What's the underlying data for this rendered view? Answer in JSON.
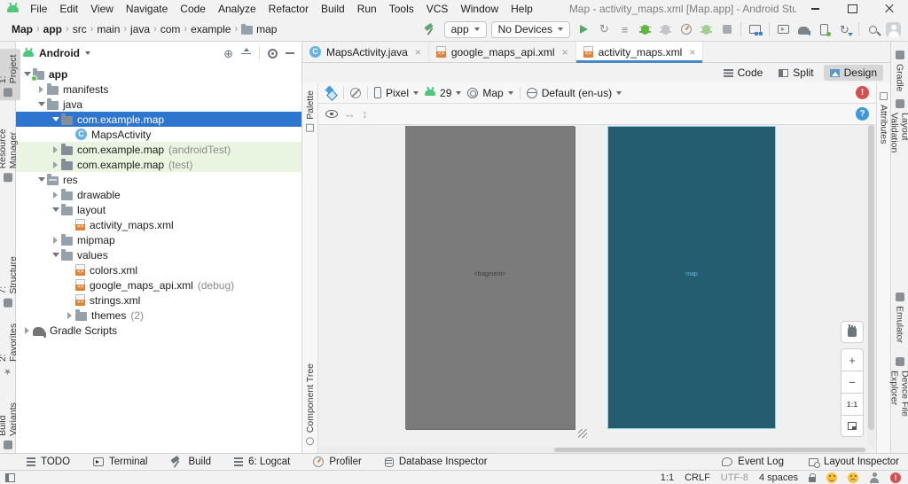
{
  "window": {
    "title": "Map - activity_maps.xml [Map.app] - Android Studio",
    "controls": [
      "minimize-icon",
      "maximize-icon",
      "close-icon"
    ]
  },
  "menubar": [
    "File",
    "Edit",
    "View",
    "Navigate",
    "Code",
    "Analyze",
    "Refactor",
    "Build",
    "Run",
    "Tools",
    "VCS",
    "Window",
    "Help"
  ],
  "breadcrumbs": [
    "Map",
    "app",
    "src",
    "main",
    "java",
    "com",
    "example",
    "map"
  ],
  "run_toolbar": {
    "config": "app",
    "devices": "No Devices",
    "icons": [
      "run-button",
      "restart-activity-button",
      "apply-changes-button",
      "debug-button",
      "attach-debugger-button",
      "profile-button",
      "apply-code-changes-button",
      "stop-button",
      "sep",
      "device-manager-button",
      "sep",
      "emulator-button",
      "sync-project-gradle-button",
      "sdk-manager-button",
      "updates-button",
      "sep",
      "search-everywhere-button",
      "avatar"
    ]
  },
  "editor_tabs": [
    {
      "label": "MapsActivity.java",
      "icon": "class-icon",
      "active": false
    },
    {
      "label": "google_maps_api.xml",
      "icon": "xml-icon",
      "active": false
    },
    {
      "label": "activity_maps.xml",
      "icon": "xml-icon",
      "active": true
    }
  ],
  "mode_switch": [
    {
      "label": "Code",
      "icon": "code-mode-icon",
      "active": false
    },
    {
      "label": "Split",
      "icon": "split-mode-icon",
      "active": false
    },
    {
      "label": "Design",
      "icon": "design-mode-icon",
      "active": true
    }
  ],
  "design_toolbar": {
    "device": "Pixel",
    "api_level": "29",
    "theme": "Map",
    "locale": "Default (en-us)",
    "error_badge": "!",
    "help_badge": "?"
  },
  "project_panel": {
    "view_selector": "Android",
    "tree": [
      {
        "depth": 0,
        "expand": "open",
        "icon": "app-module-icon",
        "label": "app",
        "bold": true
      },
      {
        "depth": 1,
        "expand": "closed",
        "icon": "folder-icon",
        "label": "manifests"
      },
      {
        "depth": 1,
        "expand": "open",
        "icon": "folder-icon",
        "label": "java"
      },
      {
        "depth": 2,
        "expand": "open",
        "icon": "package-icon",
        "label": "com.example.map",
        "selected": true
      },
      {
        "depth": 3,
        "expand": "none",
        "icon": "class-icon",
        "label": "MapsActivity"
      },
      {
        "depth": 2,
        "expand": "closed",
        "icon": "package-icon",
        "label": "com.example.map",
        "suffix": "(androidTest)",
        "highlight": "green"
      },
      {
        "depth": 2,
        "expand": "closed",
        "icon": "package-icon",
        "label": "com.example.map",
        "suffix": "(test)",
        "highlight": "green"
      },
      {
        "depth": 1,
        "expand": "open",
        "icon": "res-folder-icon",
        "label": "res"
      },
      {
        "depth": 2,
        "expand": "closed",
        "icon": "folder-icon",
        "label": "drawable"
      },
      {
        "depth": 2,
        "expand": "open",
        "icon": "folder-icon",
        "label": "layout"
      },
      {
        "depth": 3,
        "expand": "none",
        "icon": "xml-file-icon",
        "label": "activity_maps.xml"
      },
      {
        "depth": 2,
        "expand": "closed",
        "icon": "folder-icon",
        "label": "mipmap"
      },
      {
        "depth": 2,
        "expand": "open",
        "icon": "folder-icon",
        "label": "values"
      },
      {
        "depth": 3,
        "expand": "none",
        "icon": "xml-file-icon",
        "label": "colors.xml"
      },
      {
        "depth": 3,
        "expand": "none",
        "icon": "xml-file-icon",
        "label": "google_maps_api.xml",
        "suffix": "(debug)"
      },
      {
        "depth": 3,
        "expand": "none",
        "icon": "xml-file-icon",
        "label": "strings.xml"
      },
      {
        "depth": 3,
        "expand": "closed",
        "icon": "folder-icon",
        "label": "themes",
        "suffix": "(2)"
      },
      {
        "depth": 0,
        "expand": "closed",
        "icon": "gradle-icon",
        "label": "Gradle Scripts"
      }
    ]
  },
  "tool_strips": {
    "left": [
      {
        "label": "1: Project",
        "icon": "project-icon",
        "active": true
      },
      {
        "label": "Resource Manager",
        "icon": "resource-manager-icon"
      },
      {
        "label": "7: Structure",
        "icon": "structure-icon"
      },
      {
        "label": "2: Favorites",
        "icon": "favorites-icon"
      },
      {
        "label": "Build Variants",
        "icon": "build-variants-icon"
      }
    ],
    "right": [
      {
        "label": "Gradle",
        "icon": "gradle-icon"
      },
      {
        "label": "Layout Validation",
        "icon": "layout-validation-icon"
      },
      {
        "label": "Emulator",
        "icon": "emulator-icon"
      },
      {
        "label": "Device File Explorer",
        "icon": "device-file-explorer-icon"
      }
    ]
  },
  "editor_side": {
    "palette": "Palette",
    "component_tree": "Component Tree",
    "attributes": "Attributes"
  },
  "canvas": {
    "design_label": "<fragment>",
    "blueprint_label": "map",
    "design_bg": "#7b7b7b",
    "blueprint_bg": "#255d70"
  },
  "zoom_panel": {
    "zoom_in": "+",
    "zoom_out": "−",
    "zoom_ratio": "1:1"
  },
  "bottom_toolbar": {
    "left": [
      {
        "label": "TODO",
        "icon": "todo-icon"
      },
      {
        "label": "Terminal",
        "icon": "terminal-icon"
      },
      {
        "label": "Build",
        "icon": "hammer-icon"
      },
      {
        "label": "6: Logcat",
        "icon": "logcat-icon"
      },
      {
        "label": "Profiler",
        "icon": "profiler-icon"
      },
      {
        "label": "Database Inspector",
        "icon": "database-icon"
      }
    ],
    "right": [
      {
        "label": "Event Log",
        "icon": "event-log-icon"
      },
      {
        "label": "Layout Inspector",
        "icon": "layout-inspector-icon"
      }
    ]
  },
  "status_bar": {
    "items": [
      {
        "label": "1:1"
      },
      {
        "label": "CRLF"
      },
      {
        "label": "UTF-8",
        "dim": true
      },
      {
        "label": "4 spaces"
      }
    ],
    "icons": [
      "write-lock-icon",
      "happy-feedback-icon",
      "sad-feedback-icon",
      "privacy-icon",
      "error-notification-icon"
    ]
  },
  "colors": {
    "selection_blue": "#2e75d0",
    "test_green": "#e9f5e1",
    "android_green": "#4ec77c",
    "xml_orange": "#e08138",
    "error_red": "#d64f4f",
    "help_blue": "#3e97d7",
    "design_gray": "#7b7b7b",
    "blueprint_teal": "#255d70"
  }
}
